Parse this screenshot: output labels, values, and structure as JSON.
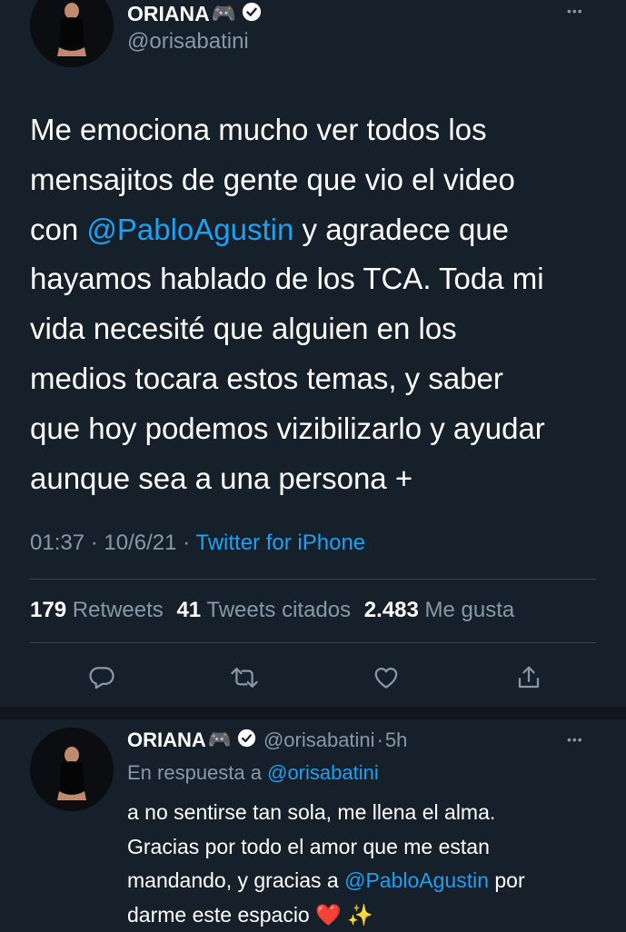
{
  "main_tweet": {
    "display_name": "ORIANA",
    "name_emoji": "🎮",
    "handle": "@orisabatini",
    "more_label": "•••",
    "text_lines": [
      [
        "Me emociona mucho ver todos los"
      ],
      [
        "mensajitos de gente que vio el video"
      ],
      [
        "con ",
        "@PabloAgustin",
        " y agradece que"
      ],
      [
        "hayamos hablado de los TCA. Toda mi"
      ],
      [
        "vida necesité que alguien en los"
      ],
      [
        "medios tocara estos temas, y saber"
      ],
      [
        "que hoy podemos vizibilizarlo y ayudar"
      ],
      [
        "aunque sea a una persona +"
      ]
    ],
    "time": "01:37",
    "date": "10/6/21",
    "source": "Twitter for iPhone",
    "retweets_count": "179",
    "retweets_label": "Retweets",
    "quotes_count": "41",
    "quotes_label": "Tweets citados",
    "likes_count": "2.483",
    "likes_label": "Me gusta"
  },
  "reply_tweet": {
    "display_name": "ORIANA",
    "name_emoji": "🎮",
    "handle": "@orisabatini",
    "age": "5h",
    "more_label": "•••",
    "in_reply_prefix": "En respuesta a",
    "in_reply_handle": "@orisabatini",
    "text_line_1": "a no sentirse tan sola, me llena el alma.",
    "text_line_2": "Gracias por todo el amor que me estan",
    "text_line_3_pre": "mandando, y gracias a ",
    "text_line_3_mention": "@PabloAgustin",
    "text_line_3_post": " por",
    "text_line_4": "darme este espacio",
    "text_emojis": "❤️ ✨"
  },
  "icons": {
    "reply": "reply-icon",
    "retweet": "retweet-icon",
    "like": "heart-icon",
    "share": "share-icon",
    "verified": "verified-badge-icon"
  },
  "colors": {
    "background": "#15202b",
    "accent": "#1da1f2",
    "secondary_text": "#8899a6",
    "divider": "#38444d"
  }
}
